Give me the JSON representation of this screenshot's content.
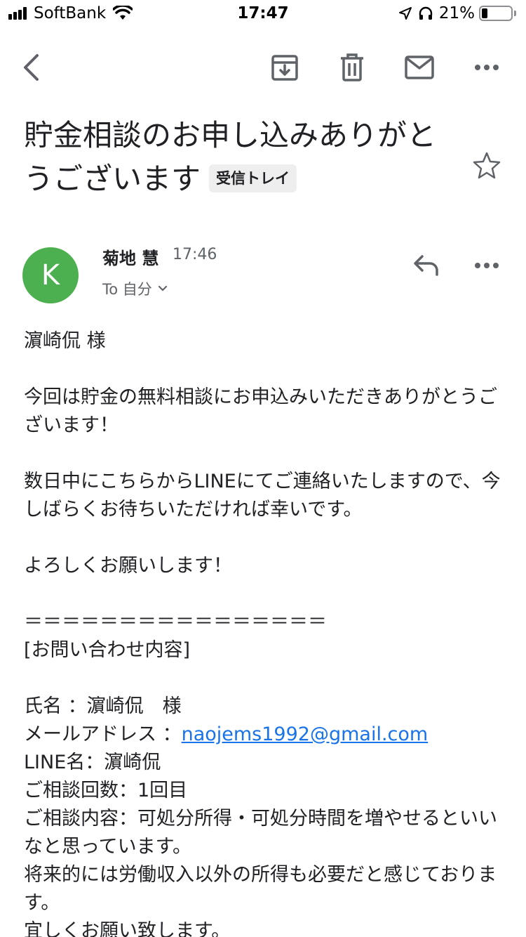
{
  "status_bar": {
    "carrier": "SoftBank",
    "time": "17:47",
    "battery_percent": "21%",
    "battery_level": 0.21
  },
  "toolbar": {
    "icons": [
      "back-arrow-icon",
      "archive-icon",
      "trash-icon",
      "mail-icon",
      "more-icon"
    ]
  },
  "email": {
    "subject": "貯金相談のお申し込みありがとうございます",
    "label": "受信トレイ",
    "sender": {
      "initial": "K",
      "name": "菊地 慧",
      "time": "17:46",
      "recipient": "To 自分",
      "avatar_color": "#4caf50"
    },
    "body": {
      "salutation": "濵崎侃 様",
      "paragraph1": "今回は貯金の無料相談にお申込みいただきありがとうございます！",
      "paragraph2": "数日中にこちらからLINEにてご連絡いたしますので、今しばらくお待ちいただければ幸いです。",
      "paragraph3": "よろしくお願いします！",
      "separator": "＝＝＝＝＝＝＝＝＝＝＝＝＝＝＝＝",
      "inquiry_heading": "[お問い合わせ内容]",
      "name_line": "氏名 ：濵崎侃　様",
      "email_label": "メールアドレス ：",
      "email_value": "naojems1992@gmail.com",
      "line_name": "LINE名：濵崎侃",
      "consult_count": "ご相談回数：1回目",
      "consult_content": "ご相談内容：可処分所得・可処分時間を増やせるといいなと思っています。",
      "consult_content2": "将来的には労働収入以外の所得も必要だと感じております。",
      "closing": "宜しくお願い致します。"
    }
  },
  "colors": {
    "accent": "#1a73e8",
    "icon_gray": "#5f6368",
    "text": "#202124"
  }
}
